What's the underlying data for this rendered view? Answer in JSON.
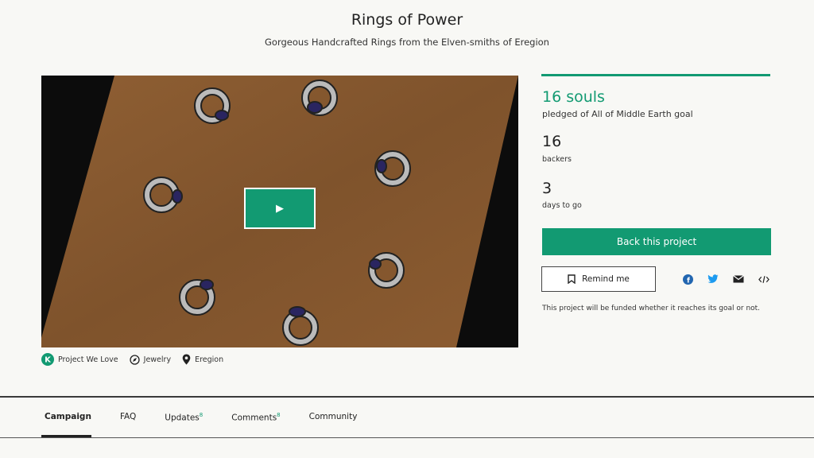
{
  "project": {
    "title": "Rings of Power",
    "subtitle": "Gorgeous Handcrafted Rings from the Elven-smiths of Eregion"
  },
  "video": {
    "play_icon": "play-icon"
  },
  "meta": {
    "badge": "Project We Love",
    "category": "Jewelry",
    "location": "Eregion"
  },
  "stats": {
    "pledged": "16 souls",
    "pledged_label": "pledged of All of Middle Earth goal",
    "backers": "16",
    "backers_label": "backers",
    "days": "3",
    "days_label": "days to go"
  },
  "actions": {
    "back_label": "Back this project",
    "remind_label": "Remind me",
    "share_icons": [
      "facebook-icon",
      "twitter-icon",
      "email-icon",
      "embed-icon"
    ],
    "funded_note": "This project will be funded whether it reaches its goal or not."
  },
  "tabs": [
    {
      "label": "Campaign",
      "badge": ""
    },
    {
      "label": "FAQ",
      "badge": ""
    },
    {
      "label": "Updates",
      "badge": "8"
    },
    {
      "label": "Comments",
      "badge": "8"
    },
    {
      "label": "Community",
      "badge": ""
    }
  ],
  "colors": {
    "accent": "#129a72",
    "paper": "#8a5a2e"
  }
}
